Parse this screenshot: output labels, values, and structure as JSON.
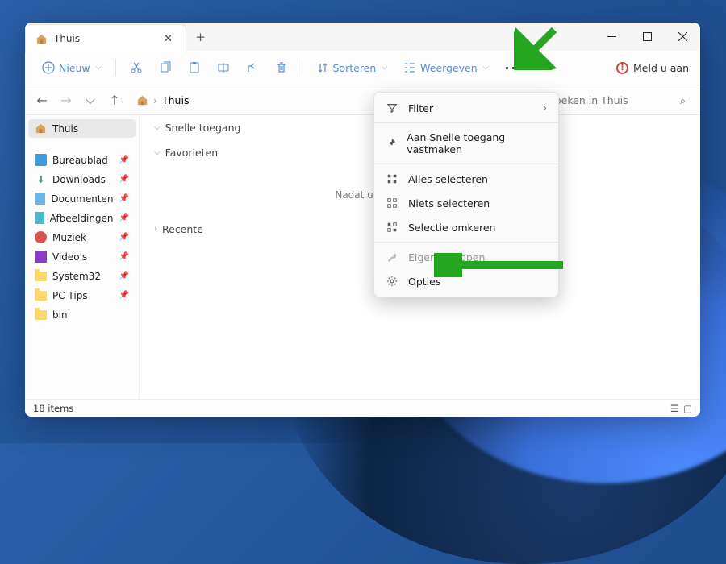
{
  "tab": {
    "label": "Thuis"
  },
  "toolbar": {
    "new": "Nieuw",
    "sort": "Sorteren",
    "view": "Weergeven"
  },
  "signin": "Meld u aan",
  "breadcrumb": "Thuis",
  "search_placeholder": "oeken in Thuis",
  "sidebar": {
    "home": "Thuis",
    "items": [
      {
        "label": "Bureaublad",
        "icon": "desktop"
      },
      {
        "label": "Downloads",
        "icon": "download"
      },
      {
        "label": "Documenten",
        "icon": "document"
      },
      {
        "label": "Afbeeldingen",
        "icon": "image"
      },
      {
        "label": "Muziek",
        "icon": "music"
      },
      {
        "label": "Video's",
        "icon": "video"
      },
      {
        "label": "System32",
        "icon": "folder"
      },
      {
        "label": "PC Tips",
        "icon": "folder"
      },
      {
        "label": "bin",
        "icon": "folder"
      }
    ]
  },
  "groups": {
    "quick": "Snelle toegang",
    "fav": "Favorieten",
    "recent": "Recente"
  },
  "empty_msg": "Nadat u enkele bestanden                                                  egeven.",
  "menu": {
    "filter": "Filter",
    "pin": "Aan Snelle toegang vastmaken",
    "selall": "Alles selecteren",
    "selnone": "Niets selecteren",
    "selinv": "Selectie omkeren",
    "props": "Eigenschappen",
    "options": "Opties"
  },
  "status": "18 items"
}
